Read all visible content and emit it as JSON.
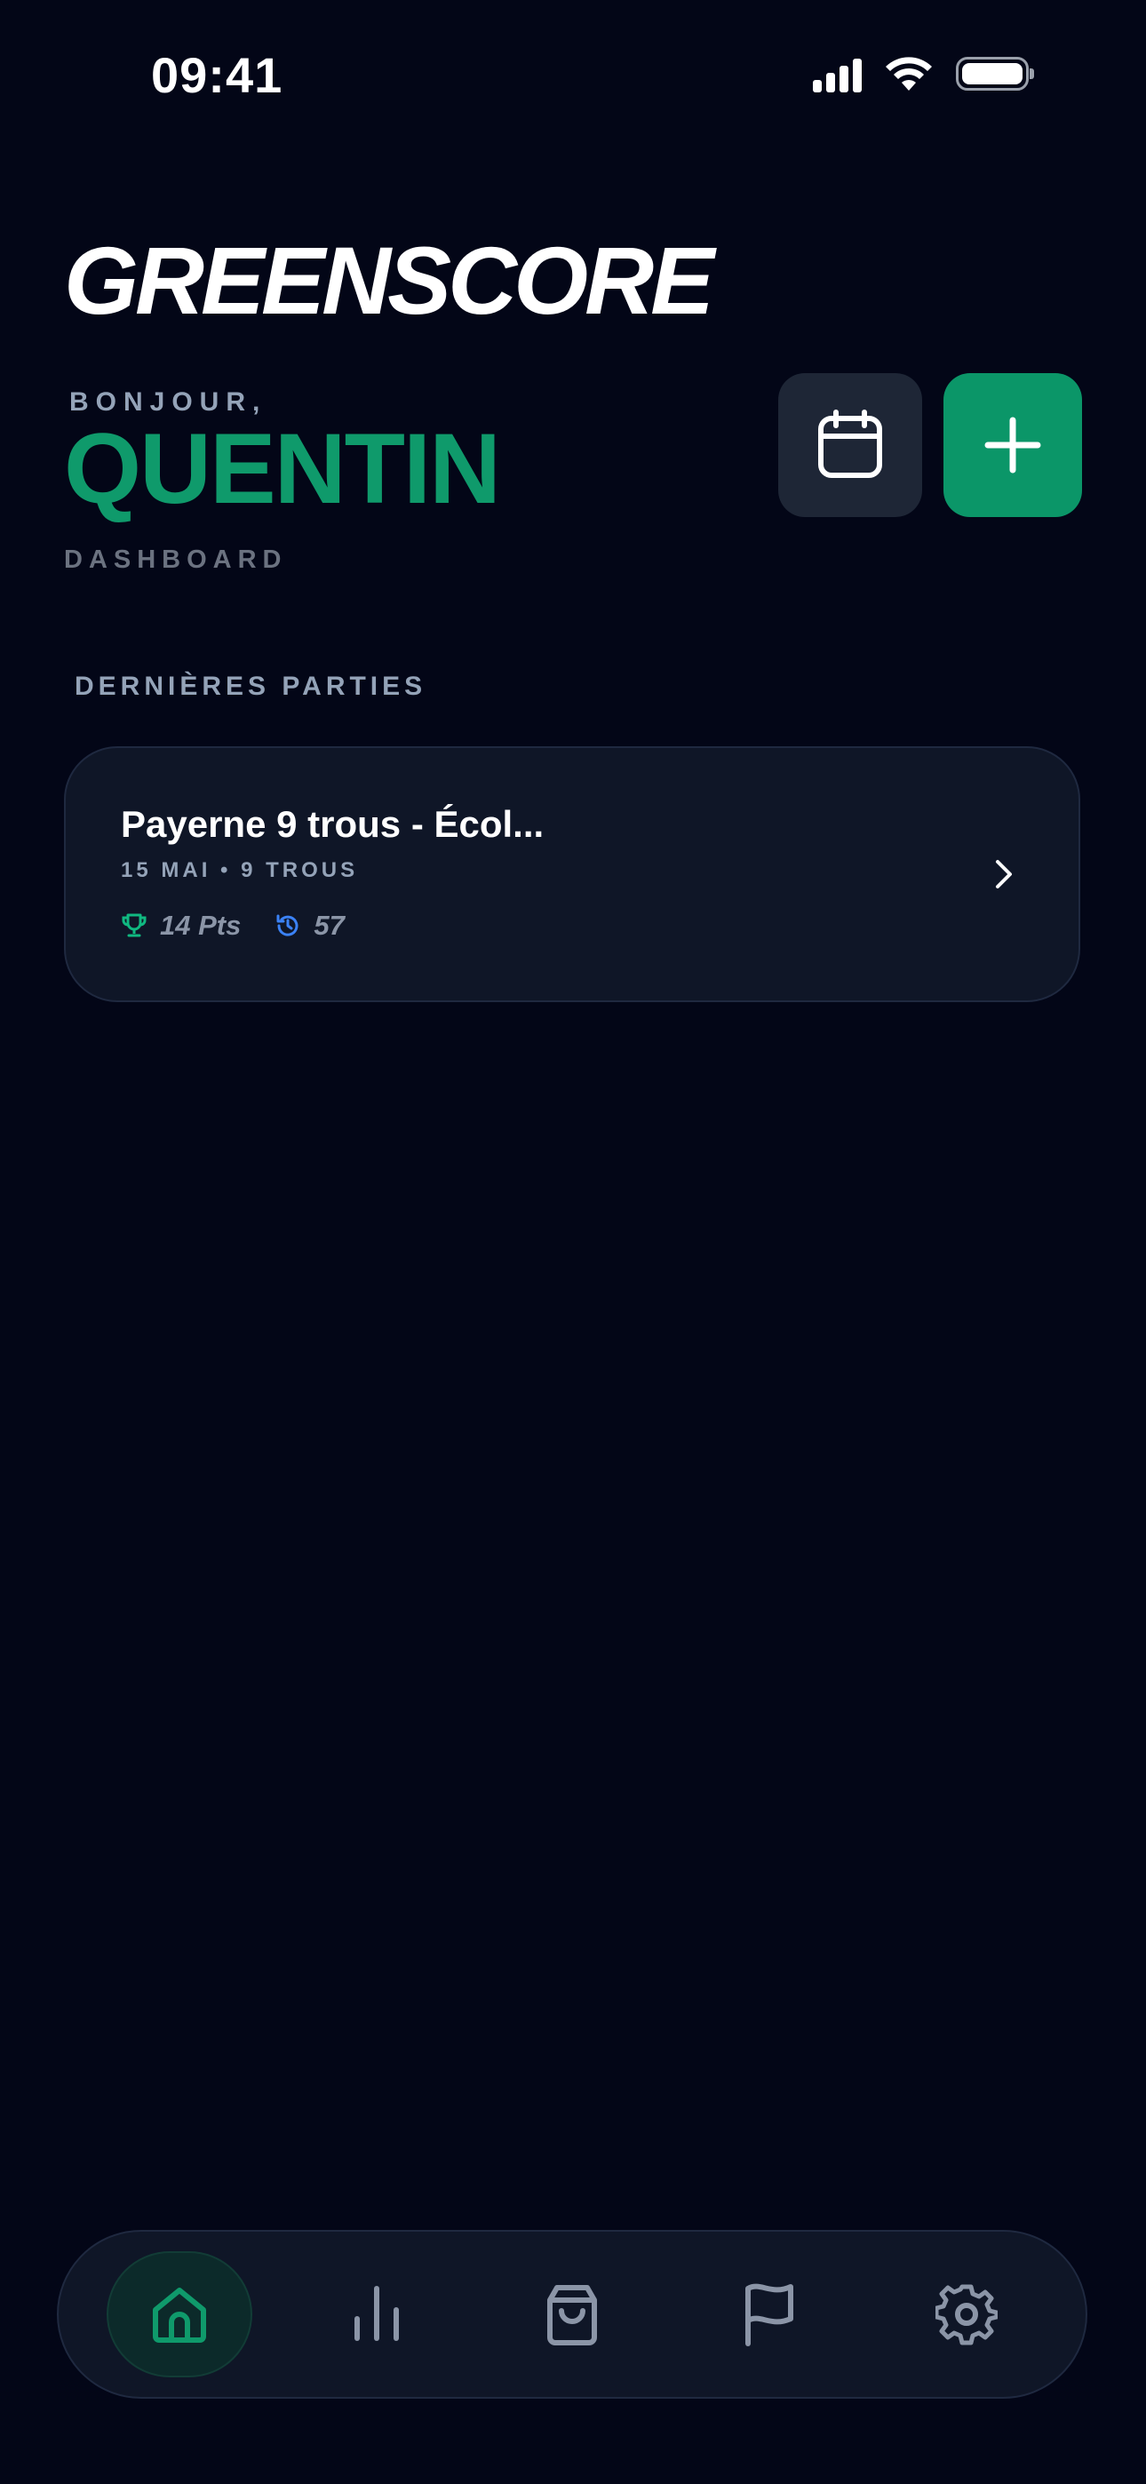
{
  "status_bar": {
    "time": "09:41",
    "icons": [
      "cellular-signal-icon",
      "wifi-icon",
      "battery-icon"
    ]
  },
  "header": {
    "app_title": "GREENSCORE",
    "greeting": "BONJOUR,",
    "user_name": "QUENTIN",
    "page_label": "DASHBOARD",
    "calendar_button_icon": "calendar-icon",
    "add_button_icon": "plus-icon"
  },
  "recent_games": {
    "section_title": "DERNIÈRES PARTIES",
    "items": [
      {
        "title": "Payerne 9 trous - Écol...",
        "meta": "15 MAI • 9 TROUS",
        "points": "14 Pts",
        "points_icon": "trophy-icon",
        "strokes": "57",
        "strokes_icon": "history-icon"
      }
    ]
  },
  "bottom_nav": {
    "active": "home",
    "items": [
      {
        "id": "home",
        "icon": "home-icon"
      },
      {
        "id": "stats",
        "icon": "bar-chart-icon"
      },
      {
        "id": "shop",
        "icon": "shopping-bag-icon"
      },
      {
        "id": "courses",
        "icon": "flag-icon"
      },
      {
        "id": "settings",
        "icon": "gear-icon"
      }
    ]
  },
  "colors": {
    "background": "#030617",
    "accent": "#0b9668",
    "card": "#0f1627",
    "muted_text": "#94a3b8",
    "points_icon": "#10b981",
    "strokes_icon": "#3b82f6"
  }
}
